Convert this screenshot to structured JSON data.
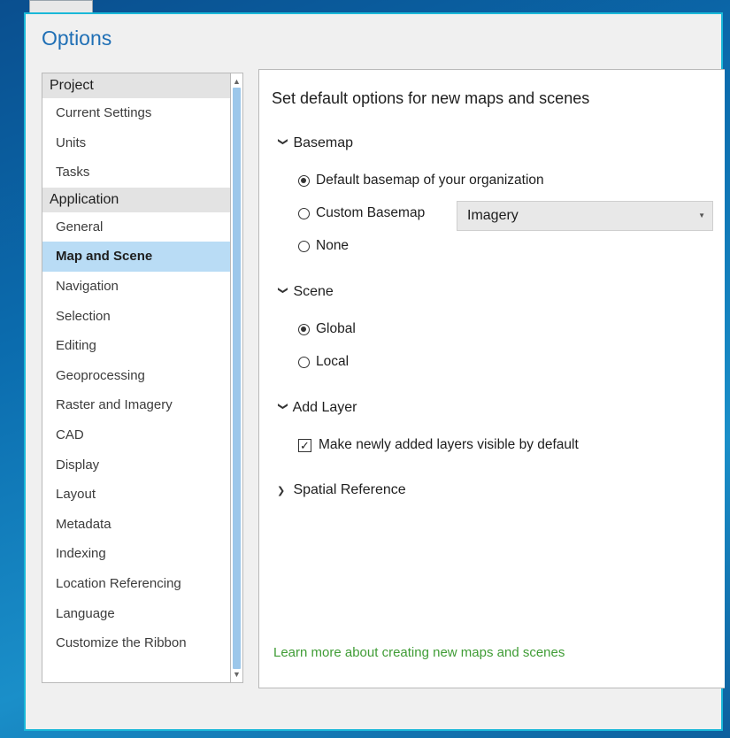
{
  "dialog": {
    "title": "Options"
  },
  "categories": {
    "project": {
      "label": "Project",
      "items": [
        "Current Settings",
        "Units",
        "Tasks"
      ]
    },
    "application": {
      "label": "Application",
      "items": [
        "General",
        "Map and Scene",
        "Navigation",
        "Selection",
        "Editing",
        "Geoprocessing",
        "Raster and Imagery",
        "CAD",
        "Display",
        "Layout",
        "Metadata",
        "Indexing",
        "Location Referencing",
        "Language",
        "Customize the Ribbon"
      ],
      "selected": "Map and Scene"
    }
  },
  "content": {
    "heading": "Set default options for new maps and scenes",
    "basemap": {
      "title": "Basemap",
      "options": [
        "Default basemap of your organization",
        "Custom Basemap",
        "None"
      ],
      "selected": "Default basemap of your organization",
      "custom_value": "Imagery"
    },
    "scene": {
      "title": "Scene",
      "options": [
        "Global",
        "Local"
      ],
      "selected": "Global"
    },
    "add_layer": {
      "title": "Add Layer",
      "checkbox_label": "Make newly added layers visible by default",
      "checked": true
    },
    "spatial_reference": {
      "title": "Spatial Reference",
      "expanded": false
    },
    "learn_more": "Learn more about creating new maps and scenes"
  },
  "icons": {
    "chevron_down": "chevron-down-icon",
    "chevron_right": "chevron-right-icon",
    "dropdown_arrow": "triangle-down-icon",
    "checkmark": "checkmark-icon"
  },
  "colors": {
    "title": "#1f6fb5",
    "selection": "#b9dcf5",
    "link": "#3f9c35",
    "dialog_border": "#1ab8d8"
  }
}
